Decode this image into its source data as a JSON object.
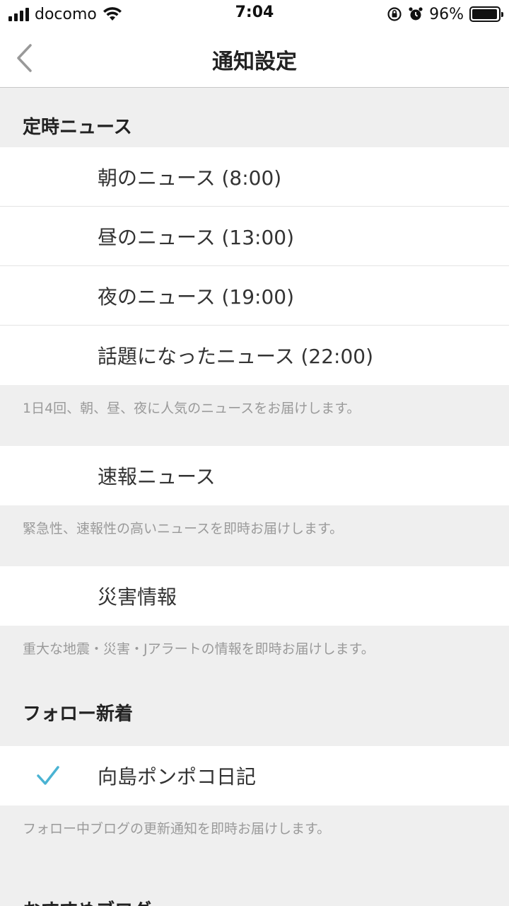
{
  "status_bar": {
    "carrier": "docomo",
    "time": "7:04",
    "battery_percent": "96%",
    "battery_level": 0.96
  },
  "nav": {
    "title": "通知設定"
  },
  "sections": {
    "scheduled": {
      "header": "定時ニュース",
      "items": [
        {
          "label": "朝のニュース (8:00)",
          "checked": false
        },
        {
          "label": "昼のニュース (13:00)",
          "checked": false
        },
        {
          "label": "夜のニュース (19:00)",
          "checked": false
        },
        {
          "label": "話題になったニュース (22:00)",
          "checked": false
        }
      ],
      "note": "1日4回、朝、昼、夜に人気のニュースをお届けします。"
    },
    "breaking": {
      "label": "速報ニュース",
      "checked": false,
      "note": "緊急性、速報性の高いニュースを即時お届けします。"
    },
    "disaster": {
      "label": "災害情報",
      "checked": false,
      "note": "重大な地震・災害・Jアラートの情報を即時お届けします。"
    },
    "follow": {
      "header": "フォロー新着",
      "items": [
        {
          "label": "向島ポンポコ日記",
          "checked": true
        }
      ],
      "note": "フォロー中ブログの更新通知を即時お届けします。"
    },
    "recommended": {
      "header": "おすすめブログ"
    }
  },
  "colors": {
    "check": "#4ab3d3",
    "background": "#efefef"
  }
}
